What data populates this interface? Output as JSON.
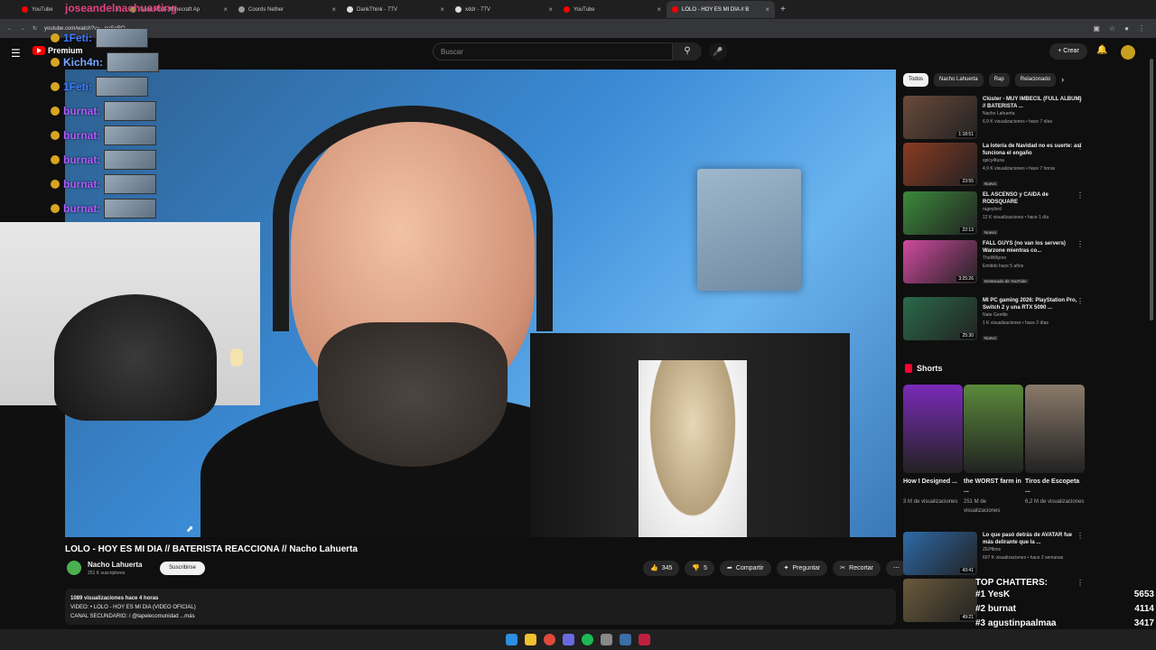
{
  "browser": {
    "tabs": [
      {
        "label": "YouTube",
        "color": "#ff0000",
        "active": false
      },
      {
        "label": "Sand Mod - Minecraft Ap",
        "color": "#7fae3d",
        "active": false
      },
      {
        "label": "Coords Nether",
        "color": "#999999",
        "active": false
      },
      {
        "label": "DankThink - 7TV",
        "color": "#dddddd",
        "active": false
      },
      {
        "label": "xddr - 7TV",
        "color": "#dddddd",
        "active": false
      },
      {
        "label": "YouTube",
        "color": "#ff0000",
        "active": false
      },
      {
        "label": "LOLO - HOY ES MI DIA // B",
        "color": "#ff0000",
        "active": true
      }
    ],
    "url": "youtube.com/watch?v=...paSeRQ"
  },
  "header": {
    "logo": "Premium",
    "search_placeholder": "Buscar",
    "create_label": "Crear"
  },
  "overlay": {
    "top_name": "joseandelnachuarting",
    "chat": [
      {
        "name": "1Feti:",
        "color": "#3d7cff"
      },
      {
        "name": "Kich4n:",
        "color": "#7aa8ff"
      },
      {
        "name": "1Feti:",
        "color": "#3d7cff"
      },
      {
        "name": "burnat:",
        "color": "#b05cff"
      },
      {
        "name": "burnat:",
        "color": "#b05cff"
      },
      {
        "name": "burnat:",
        "color": "#b05cff"
      },
      {
        "name": "burnat:",
        "color": "#b05cff"
      },
      {
        "name": "burnat:",
        "color": "#b05cff"
      }
    ],
    "top_chatters": {
      "title": "TOP CHATTERS:",
      "rows": [
        {
          "rank": "#1",
          "name": "YesK",
          "count": "5653"
        },
        {
          "rank": "#2",
          "name": "burnat",
          "count": "4114"
        },
        {
          "rank": "#3",
          "name": "agustinpaalmaa",
          "count": "3417"
        }
      ]
    }
  },
  "video": {
    "title": "LOLO - HOY ES MI DIA // BATERISTA REACCIONA // Nacho Lahuerta",
    "channel": "Nacho Lahuerta",
    "subscribers": "251 K suscriptores",
    "subscribe_label": "Suscribirse",
    "likes": "345",
    "dislikes": "5",
    "share_label": "Compartir",
    "ask_label": "Preguntar",
    "clip_label": "Recortar",
    "description": {
      "stats": "1089 visualizaciones  hace 4 horas",
      "line1": "VIDEO:  • LOLO - HOY ES MI DIA (VIDEO OFICIAL)",
      "line2": "CANAL SECUNDARIO:  / @lapelecomunidad  ...más"
    }
  },
  "sidebar": {
    "chips": [
      "Todos",
      "Nacho Lahuerta",
      "Rap",
      "Relacionado"
    ],
    "videos": [
      {
        "title": "Clúster - MUY IMBECIL (FULL ALBUM) // BATERISTA ...",
        "channel": "Nacho Lahuerta",
        "meta": "6,9 K visualizaciones • hace 7 días",
        "duration": "1:18:51",
        "badge": "",
        "color": "#6b4a3a"
      },
      {
        "title": "La lotería de Navidad no es suerte: así funciona el engaño",
        "channel": "spicy4tuna",
        "meta": "4,9 K visualizaciones • hace 7 horas",
        "duration": "23:55",
        "badge": "Nuevo",
        "color": "#8a3a22"
      },
      {
        "title": "EL ASCENSO y CAIDA de RODSQUARE",
        "channel": "rageylord",
        "meta": "12 K visualizaciones • hace 1 día",
        "duration": "22:13",
        "badge": "Nuevo",
        "color": "#3b8a3b"
      },
      {
        "title": "FALL GUYS (no van los servers) Warzone mientras co...",
        "channel": "TheWillyrex",
        "meta": "Emitido hace 5 años",
        "duration": "3:25:26",
        "badge": "Destacado de YouTube",
        "color": "#d04aa0"
      },
      {
        "title": "MI PC gaming 2026: PlayStation Pro, Switch 2 y una RTX 5090 ...",
        "channel": "Nate Gentile",
        "meta": "1 K visualizaciones • hace 2 días",
        "duration": "25:30",
        "badge": "Nuevo",
        "color": "#2a6a4a"
      },
      {
        "title": "Lo que pasó detrás de AVATAR fue más delirante que la ...",
        "channel": "ZEPfilms",
        "meta": "607 K visualizaciones • hace 2 semanas",
        "duration": "43:41",
        "badge": "",
        "color": "#2d6aa8"
      },
      {
        "title": "",
        "channel": "",
        "meta": "",
        "duration": "49:21",
        "badge": "",
        "color": "#6a5a3a"
      }
    ],
    "shorts_title": "Shorts",
    "shorts": [
      {
        "title": "How I Designed ...",
        "views": "3 M de visualizaciones",
        "color": "#7a2ab8"
      },
      {
        "title": "the WORST farm in ...",
        "views": "251 M de visualizaciones",
        "color": "#5a8a3a"
      },
      {
        "title": "Tiros de Escopeta ...",
        "views": "6,2 M de visualizaciones",
        "color": "#8a7a6a"
      }
    ]
  }
}
